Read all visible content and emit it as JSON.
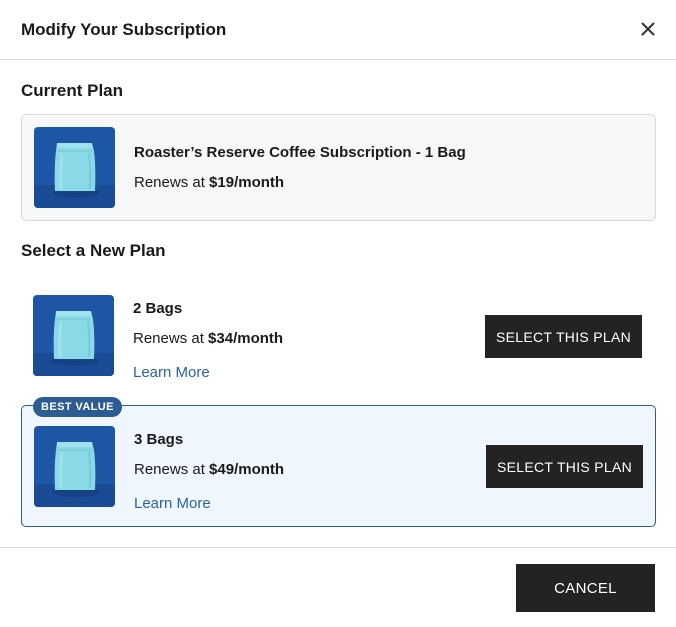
{
  "modal": {
    "title": "Modify Your Subscription",
    "close_icon": "close-icon"
  },
  "current_plan": {
    "section_title": "Current Plan",
    "name": "Roaster’s Reserve Coffee Subscription - 1 Bag",
    "renew_prefix": "Renews at ",
    "price": "$19/month",
    "image_icon": "coffee-bag-icon"
  },
  "new_plans": {
    "section_title": "Select a New Plan",
    "items": [
      {
        "name": "2 Bags",
        "renew_prefix": "Renews at ",
        "price": "$34/month",
        "learn_more": "Learn More",
        "select_label": "SELECT THIS PLAN",
        "image_icon": "coffee-bag-icon"
      },
      {
        "badge": "BEST VALUE",
        "name": "3 Bags",
        "renew_prefix": "Renews at ",
        "price": "$49/month",
        "learn_more": "Learn More",
        "select_label": "SELECT THIS PLAN",
        "image_icon": "coffee-bag-icon"
      }
    ]
  },
  "footer": {
    "cancel_label": "CANCEL"
  },
  "colors": {
    "accent": "#2b5c92",
    "link": "#2a63a3",
    "button_bg": "#232323",
    "highlight_bg": "#eff6fe",
    "product_bg": "#1e56a6",
    "product_bag": "#8ad9e6"
  }
}
